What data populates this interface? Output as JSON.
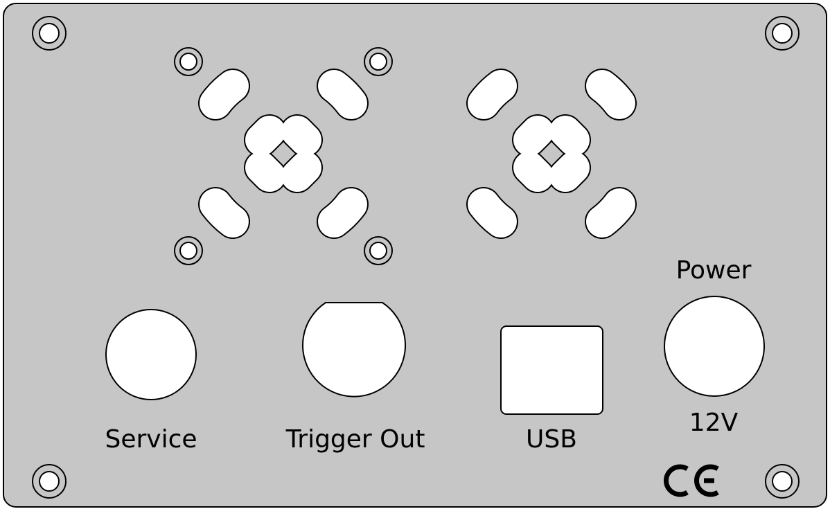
{
  "panel": {
    "background": "#c6c6c6",
    "outline": "#000000",
    "hole_fill": "#ffffff"
  },
  "labels": {
    "service": "Service",
    "trigger_out": "Trigger Out",
    "usb": "USB",
    "power": "Power",
    "voltage": "12V",
    "ce_mark": "CE"
  },
  "icons": {
    "mounting_screw": "mounting-screw-icon",
    "fan_grille": "fan-grille-icon",
    "ce_mark": "ce-mark-icon"
  }
}
